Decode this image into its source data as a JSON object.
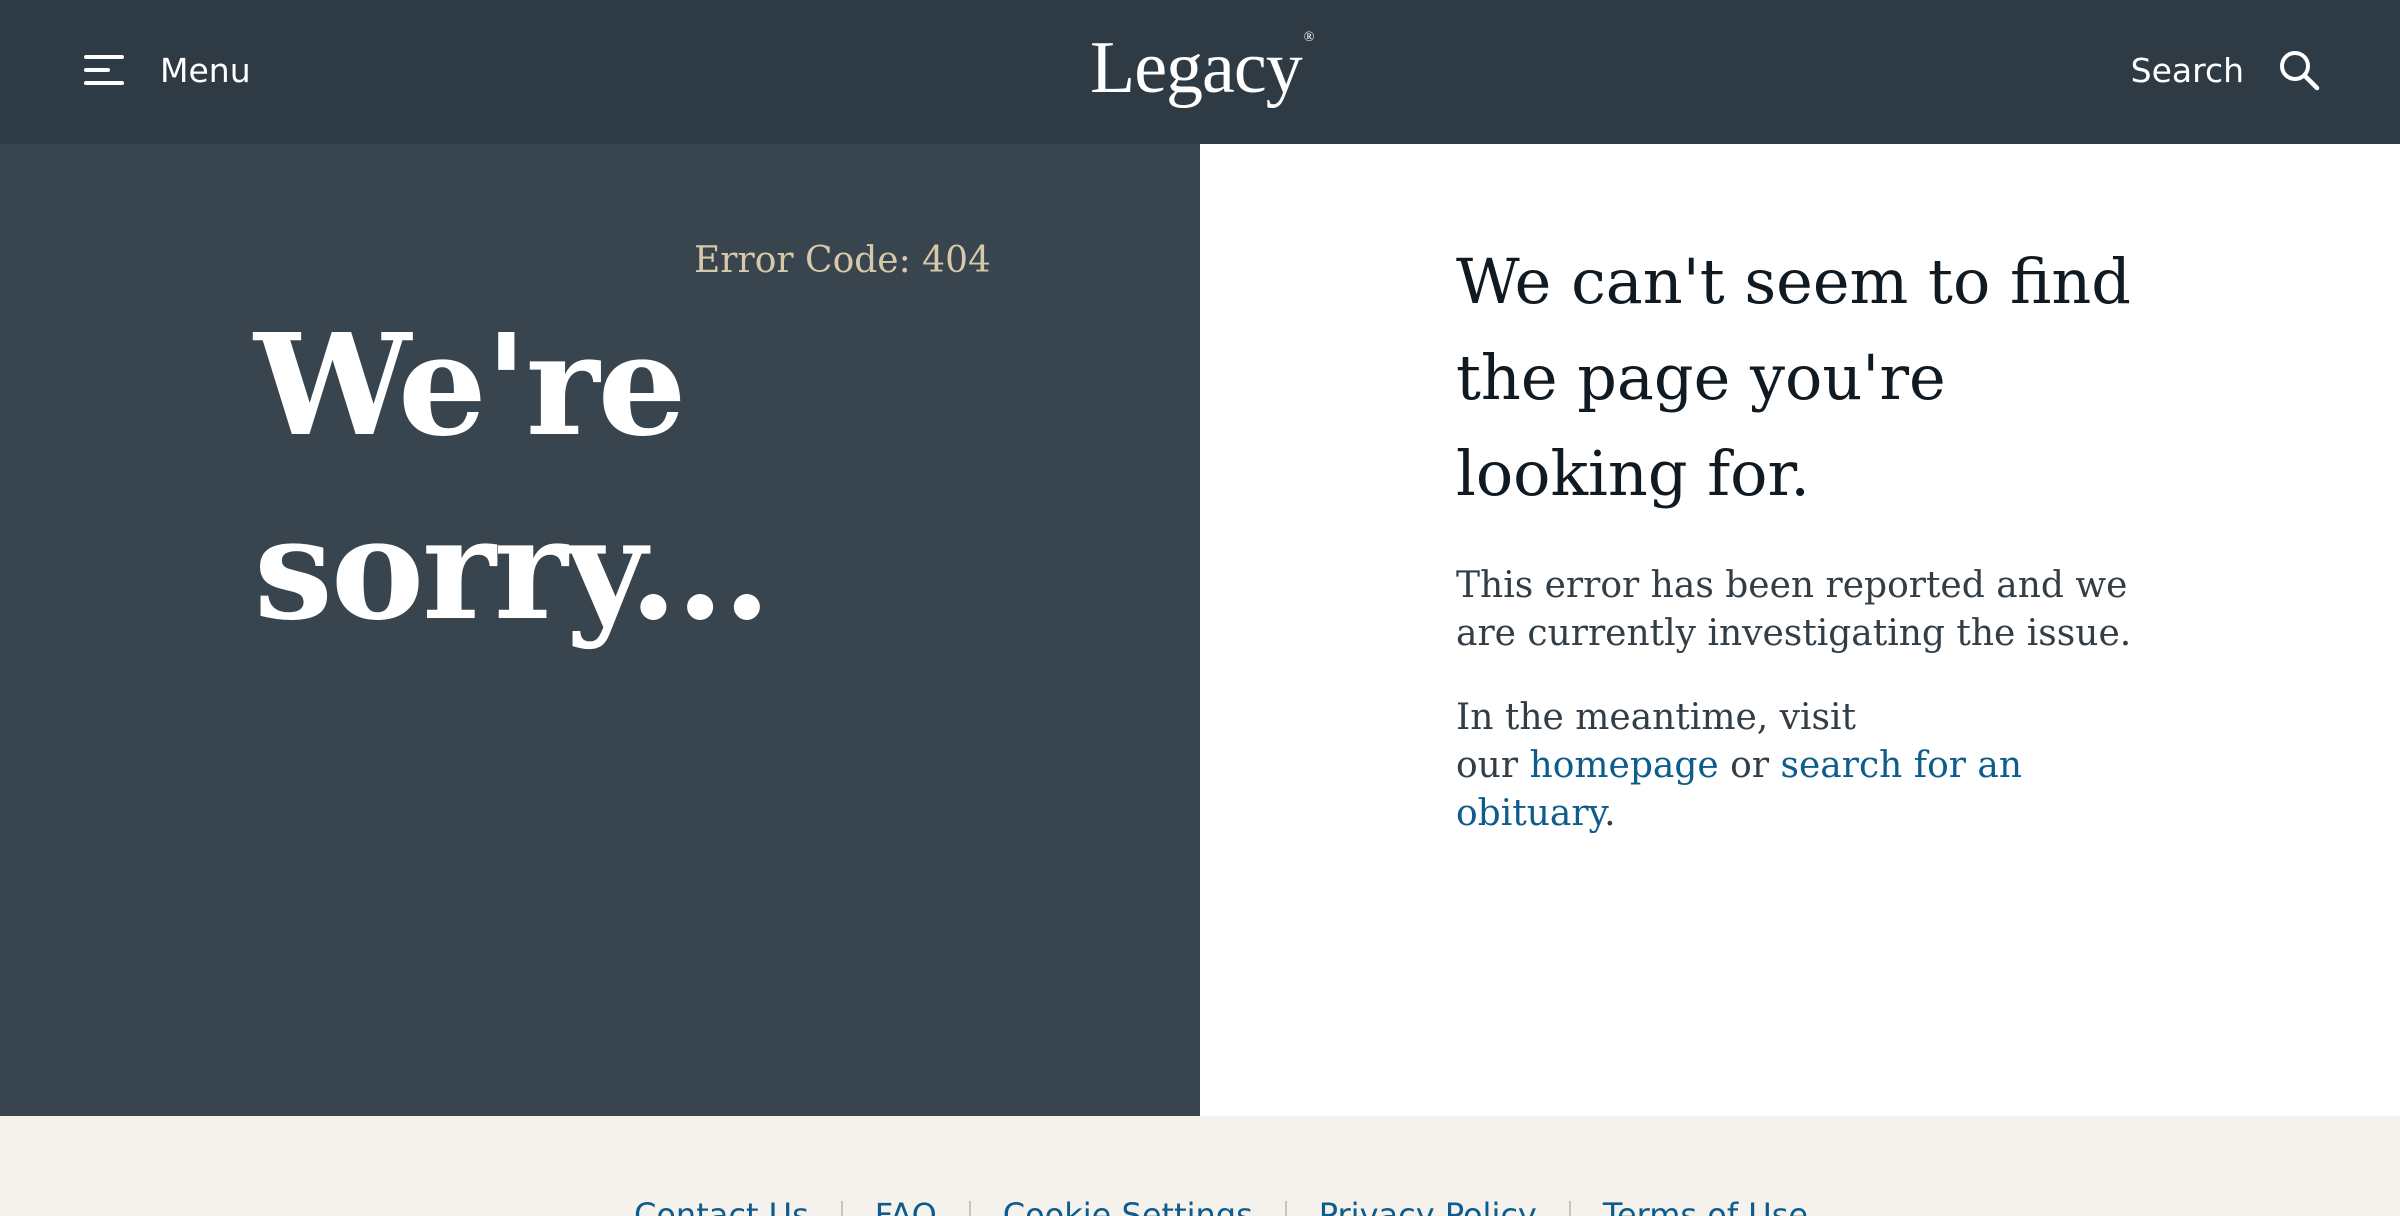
{
  "header": {
    "menu_label": "Menu",
    "logo_text": "Legacy",
    "logo_mark": "®",
    "search_label": "Search"
  },
  "left": {
    "error_code": "Error Code: 404",
    "sorry_line1": "We're",
    "sorry_line2": "sorry..."
  },
  "right": {
    "headline": "We can't seem to find the page you're looking for.",
    "paragraph1": "This error has been reported and we are currently investigating the issue.",
    "paragraph2_prefix": "In the meantime, visit",
    "paragraph2_our": "our",
    "homepage_link": "homepage",
    "or_text": "or",
    "obituary_link": "search for an obituary",
    "period": "."
  },
  "footer": {
    "links": [
      "Contact Us",
      "FAQ",
      "Cookie Settings",
      "Privacy Policy",
      "Terms of Use"
    ]
  },
  "colors": {
    "header_bg": "#2e3a44",
    "left_panel_bg": "#38454f",
    "error_code": "#d8c8aa",
    "link": "#0d5c8c",
    "footer_bg": "#f5f2ed"
  },
  "icons": {
    "menu": "hamburger-icon",
    "search": "search-icon"
  }
}
